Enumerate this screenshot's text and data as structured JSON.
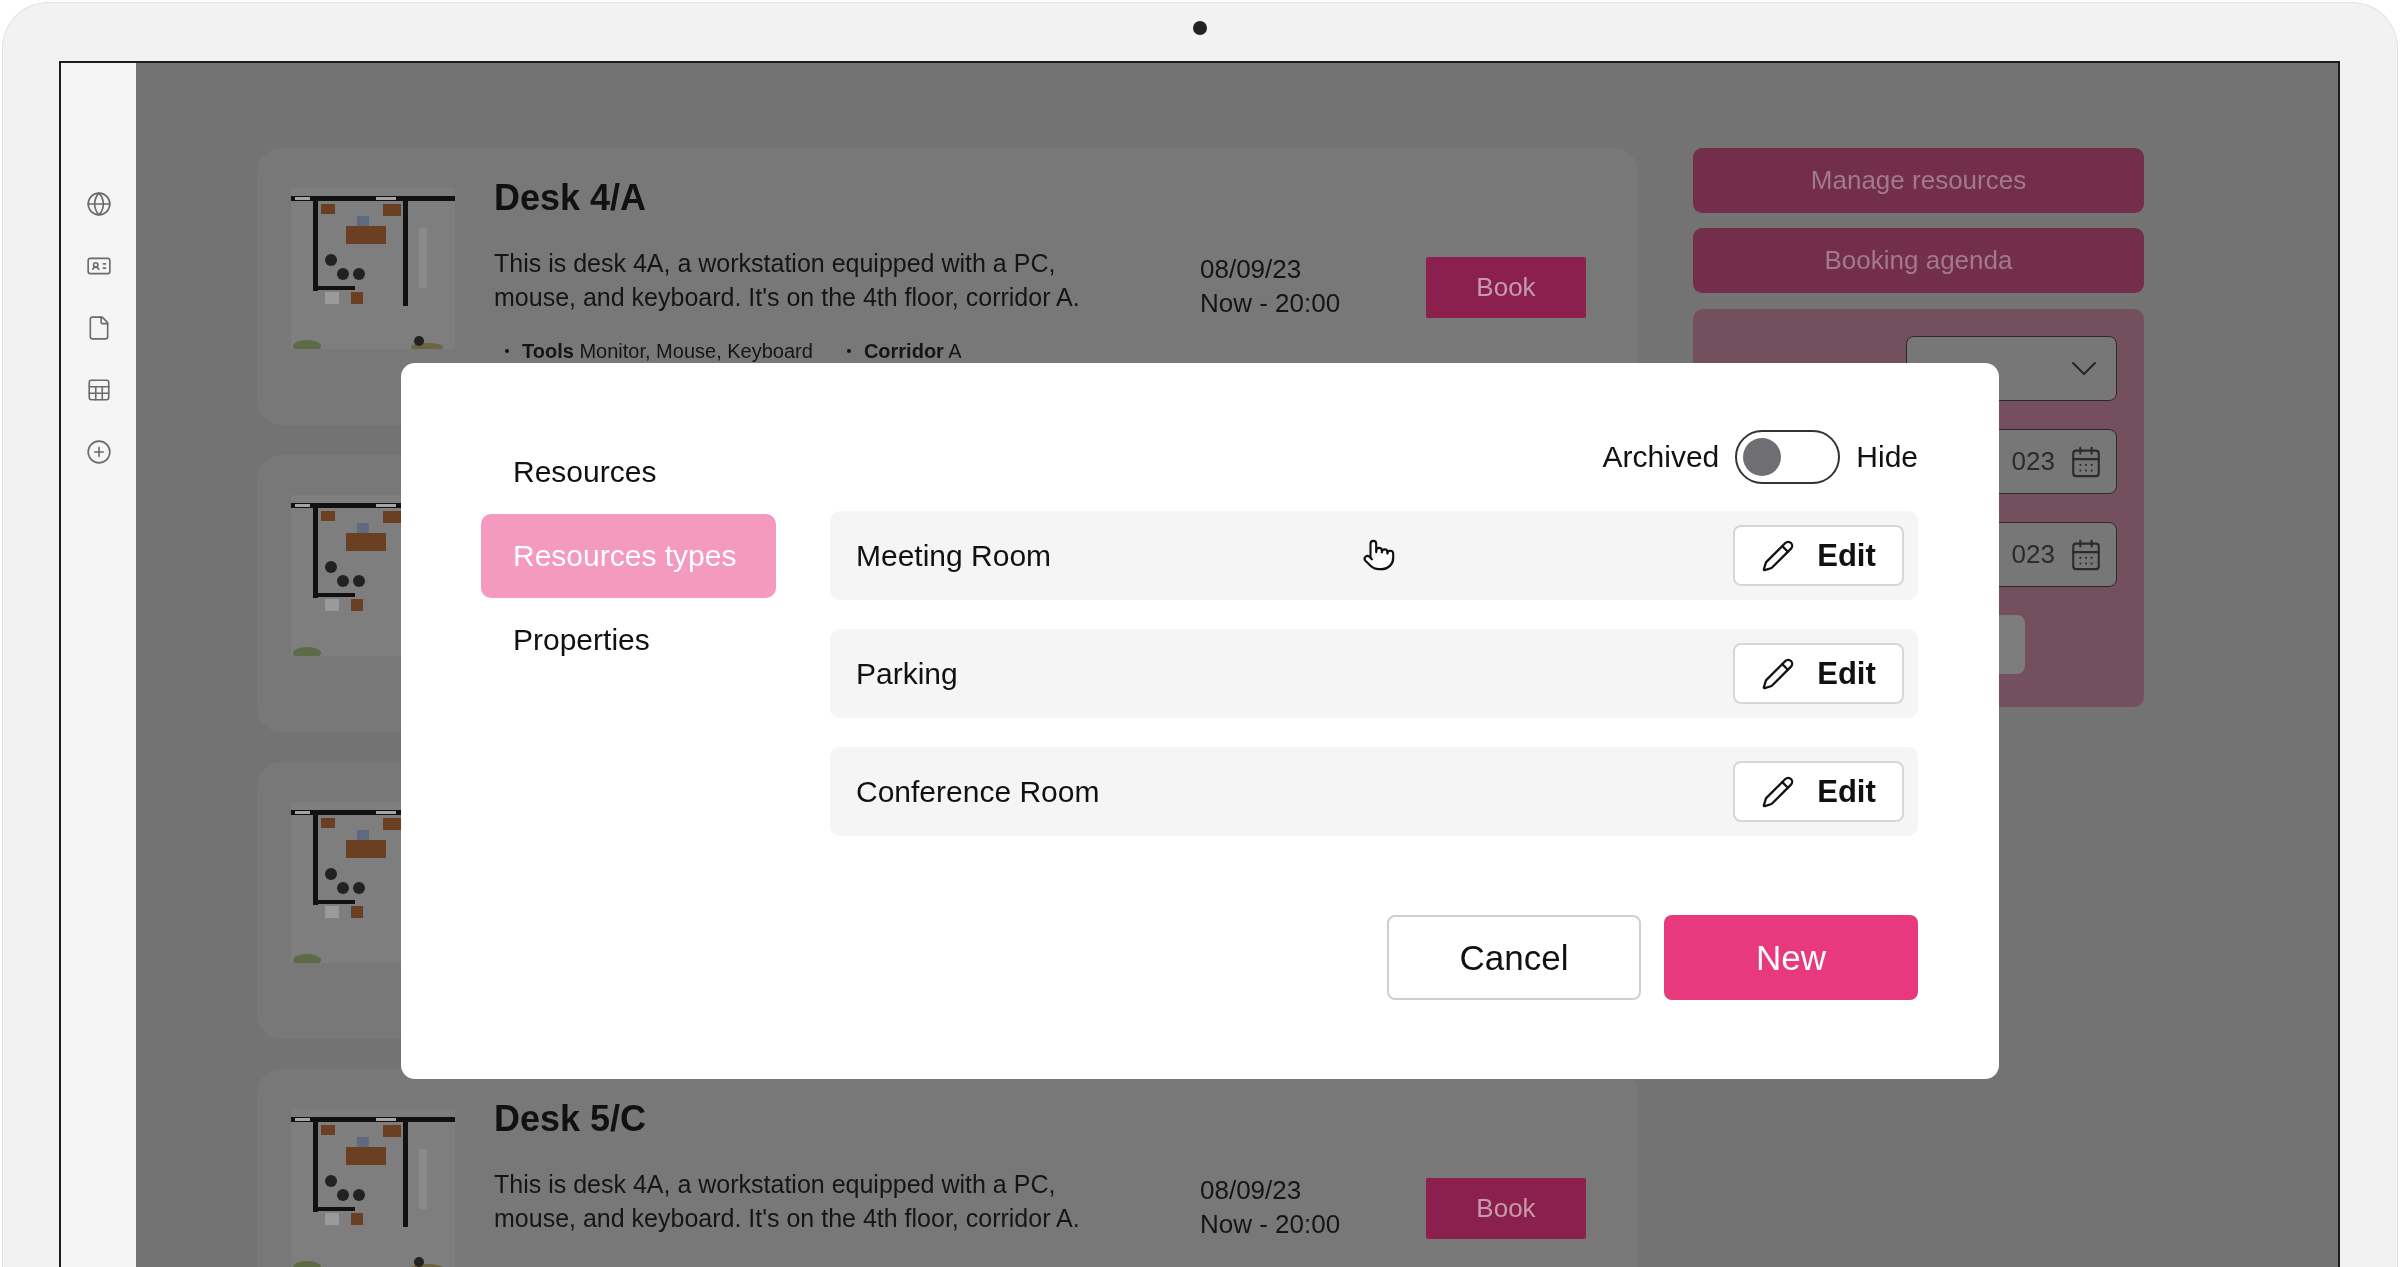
{
  "listings": [
    {
      "kind": "full",
      "title": "Desk 4/A",
      "description": "This is desk 4A, a workstation equipped with a PC, mouse, and keyboard. It's on the 4th floor, corridor A.",
      "tags": [
        "**Tools** Monitor, Mouse, Keyboard",
        "**Corridor** A"
      ],
      "date": "08/09/23",
      "time": "Now - 20:00",
      "action": "Book"
    },
    {
      "kind": "image_only"
    },
    {
      "kind": "image_only"
    },
    {
      "kind": "full",
      "title": "Desk 5/C",
      "description": "This is desk 4A, a workstation equipped with a PC, mouse, and keyboard. It's on the 4th floor, corridor A.",
      "date": "08/09/23",
      "time": "Now - 20:00",
      "action": "Book"
    }
  ],
  "side_panel": {
    "buttons": [
      "Manage resources",
      "Booking agenda"
    ],
    "date_fields": [
      {
        "value": "023"
      },
      {
        "value": "023"
      }
    ]
  },
  "modal": {
    "nav": [
      {
        "label": "Resources",
        "selected": false
      },
      {
        "label": "Resources types",
        "selected": true
      },
      {
        "label": "Properties",
        "selected": false
      }
    ],
    "archived_toggle": {
      "label": "Archived",
      "on": false,
      "state_label": "Hide"
    },
    "rows": [
      {
        "name": "Meeting Room",
        "action": "Edit"
      },
      {
        "name": "Parking",
        "action": "Edit"
      },
      {
        "name": "Conference Room",
        "action": "Edit"
      }
    ],
    "buttons": [
      {
        "label": "Cancel",
        "kind": "secondary"
      },
      {
        "label": "New",
        "kind": "primary"
      }
    ]
  }
}
